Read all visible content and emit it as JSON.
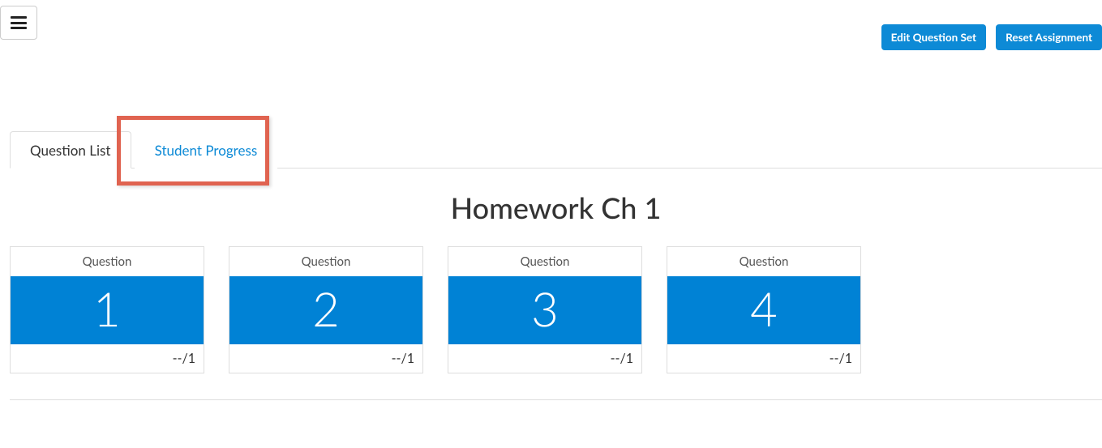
{
  "header": {
    "edit_label": "Edit Question Set",
    "reset_label": "Reset Assignment"
  },
  "tabs": {
    "question_list": "Question List",
    "student_progress": "Student Progress"
  },
  "page_title": "Homework Ch 1",
  "card_header_label": "Question",
  "questions": [
    {
      "number": "1",
      "score": "--/1"
    },
    {
      "number": "2",
      "score": "--/1"
    },
    {
      "number": "3",
      "score": "--/1"
    },
    {
      "number": "4",
      "score": "--/1"
    }
  ],
  "colors": {
    "primary": "#0082d5",
    "button": "#0d8ad6",
    "highlight": "#e06350"
  }
}
